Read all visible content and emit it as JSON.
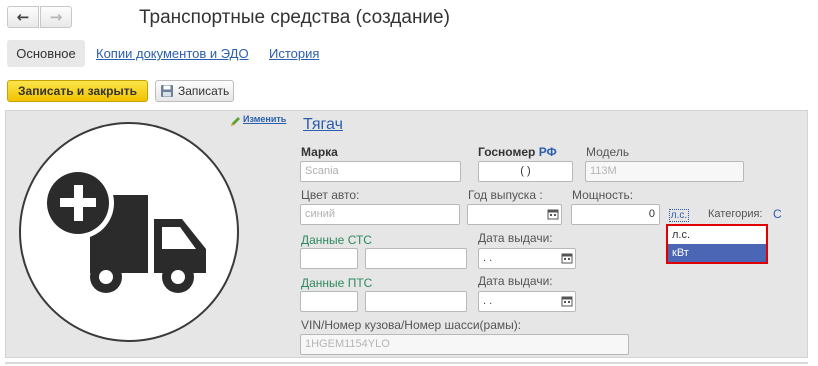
{
  "window": {
    "title": "Транспортные средства (создание)"
  },
  "nav": {
    "back_glyph": "←",
    "forward_glyph": "→"
  },
  "tabs": [
    {
      "label": "Основное",
      "active": true
    },
    {
      "label": "Копии документов и ЭДО",
      "active": false
    },
    {
      "label": "История",
      "active": false
    }
  ],
  "toolbar": {
    "save_close_label": "Записать и закрыть",
    "save_label": "Записать",
    "save_icon": "floppy-disk-icon"
  },
  "photo": {
    "edit_link": "Изменить",
    "icon": "add-truck-icon"
  },
  "form": {
    "type_link": "Тягач",
    "brand": {
      "label": "Марка",
      "placeholder": "Scania"
    },
    "plate": {
      "label": "Госномер",
      "suffix": "РФ",
      "value": "(  )"
    },
    "model": {
      "label": "Модель",
      "placeholder": "113M"
    },
    "color": {
      "label": "Цвет авто:",
      "placeholder": "синий"
    },
    "year": {
      "label": "Год выпуска  :"
    },
    "power": {
      "label": "Мощность:",
      "value": "0",
      "unit": "л.с."
    },
    "category": {
      "label": "Категория:",
      "value": "С"
    },
    "sts": {
      "label": "Данные СТС",
      "date_label": "Дата выдачи:",
      "date_value": " .  ."
    },
    "pts": {
      "label": "Данные ПТС",
      "date_label": "Дата выдачи:",
      "date_value": " .  ."
    },
    "vin": {
      "label": "VIN/Номер кузова/Номер шасси(рамы):",
      "placeholder": "1HGEM1154YLO"
    }
  },
  "power_unit_options": [
    {
      "label": "л.с.",
      "selected": false
    },
    {
      "label": "кВт",
      "selected": true
    }
  ],
  "colors": {
    "accent_yellow": "#f2c200",
    "link_blue": "#2b5fad",
    "green_label": "#2f8a5f",
    "dropdown_highlight": "#4a66b5",
    "dropdown_border": "#e00000"
  }
}
